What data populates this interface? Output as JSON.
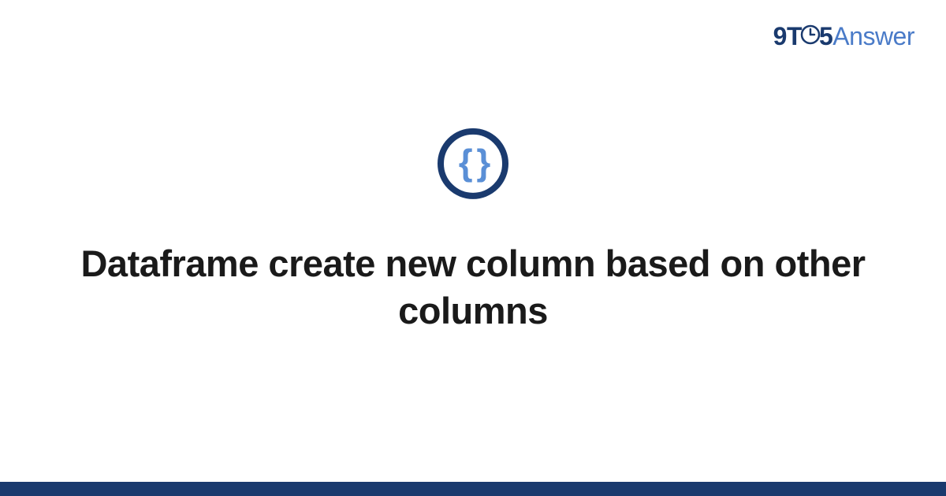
{
  "logo": {
    "part1": "9",
    "part2": "T",
    "part3": "5",
    "part4": "Answer"
  },
  "icon": {
    "symbol": "{ }",
    "name": "braces-icon"
  },
  "title": "Dataframe create new column based on other columns",
  "colors": {
    "darkBlue": "#1a3a6e",
    "lightBlue": "#4a7bc8",
    "braceBlue": "#5a8fd6"
  }
}
